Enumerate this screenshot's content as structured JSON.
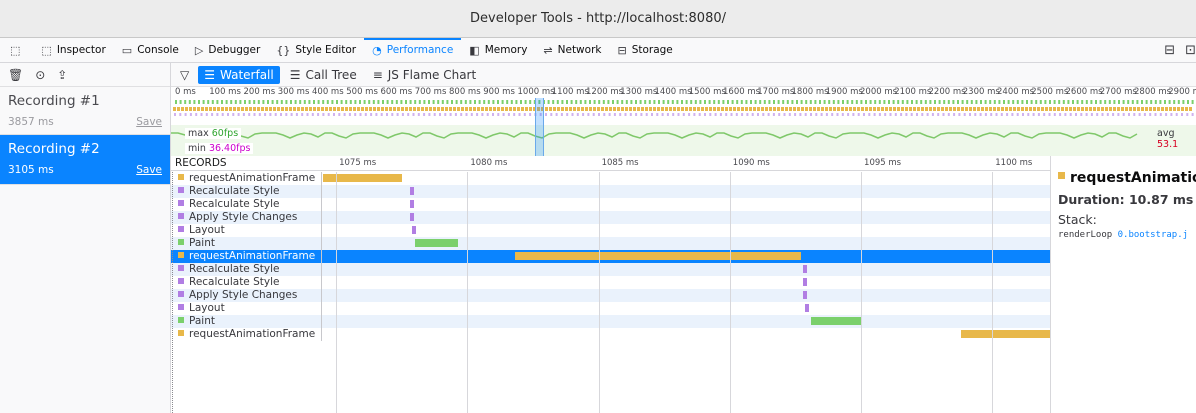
{
  "window": {
    "title": "Developer Tools - http://localhost:8080/"
  },
  "toolbar": {
    "tools": [
      {
        "label": "Inspector",
        "icon": "inspector-icon",
        "glyph": "⬚"
      },
      {
        "label": "Console",
        "icon": "console-icon",
        "glyph": "▭"
      },
      {
        "label": "Debugger",
        "icon": "debugger-icon",
        "glyph": "▷"
      },
      {
        "label": "Style Editor",
        "icon": "style-editor-icon",
        "glyph": "{}"
      },
      {
        "label": "Performance",
        "icon": "performance-icon",
        "glyph": "◔",
        "active": true
      },
      {
        "label": "Memory",
        "icon": "memory-icon",
        "glyph": "◧"
      },
      {
        "label": "Network",
        "icon": "network-icon",
        "glyph": "⇌"
      },
      {
        "label": "Storage",
        "icon": "storage-icon",
        "glyph": "⊟"
      }
    ]
  },
  "sidebar": {
    "recordings": [
      {
        "name": "Recording #1",
        "duration": "3857 ms",
        "save": "Save",
        "selected": false
      },
      {
        "name": "Recording #2",
        "duration": "3105 ms",
        "save": "Save",
        "selected": true
      }
    ]
  },
  "subtabs": [
    {
      "label": "Waterfall",
      "icon": "waterfall-icon",
      "active": true
    },
    {
      "label": "Call Tree",
      "icon": "call-tree-icon",
      "active": false
    },
    {
      "label": "JS Flame Chart",
      "icon": "flame-chart-icon",
      "active": false
    }
  ],
  "overview": {
    "ruler": [
      "0 ms",
      "100 ms",
      "200 ms",
      "300 ms",
      "400 ms",
      "500 ms",
      "600 ms",
      "700 ms",
      "800 ms",
      "900 ms",
      "1000 ms",
      "1100 ms",
      "1200 ms",
      "1300 ms",
      "1400 ms",
      "1500 ms",
      "1600 ms",
      "1700 ms",
      "1800 ms",
      "1900 ms",
      "2000 ms",
      "2100 ms",
      "2200 ms",
      "2300 ms",
      "2400 ms",
      "2500 ms",
      "2600 ms",
      "2700 ms",
      "2800 ms",
      "2900 ms"
    ],
    "fps": {
      "max_label": "max",
      "max_value": "60fps",
      "min_label": "min",
      "min_value": "36.40fps",
      "avg_label": "avg",
      "avg_value": "53.1"
    }
  },
  "waterfall": {
    "records_header": "RECORDS",
    "ticks": [
      "1075 ms",
      "1080 ms",
      "1085 ms",
      "1090 ms",
      "1095 ms",
      "1100 ms"
    ],
    "tick_values": [
      1075,
      1080,
      1085,
      1090,
      1095,
      1100
    ],
    "view_range_ms": [
      1074.5,
      1102.2
    ],
    "markers": [
      {
        "name": "requestAnimationFrame",
        "type": "script",
        "start": 1074.5,
        "end": 1077.5
      },
      {
        "name": "Recalculate Style",
        "type": "style",
        "start": 1077.8,
        "end": 1077.95
      },
      {
        "name": "Recalculate Style",
        "type": "style",
        "start": 1077.8,
        "end": 1077.95
      },
      {
        "name": "Apply Style Changes",
        "type": "style",
        "start": 1077.8,
        "end": 1077.95
      },
      {
        "name": "Layout",
        "type": "style",
        "start": 1077.9,
        "end": 1078.05
      },
      {
        "name": "Paint",
        "type": "paint",
        "start": 1078.0,
        "end": 1079.65
      },
      {
        "name": "requestAnimationFrame",
        "type": "script",
        "start": 1081.8,
        "end": 1092.7,
        "selected": true
      },
      {
        "name": "Recalculate Style",
        "type": "style",
        "start": 1092.8,
        "end": 1092.95
      },
      {
        "name": "Recalculate Style",
        "type": "style",
        "start": 1092.8,
        "end": 1092.95
      },
      {
        "name": "Apply Style Changes",
        "type": "style",
        "start": 1092.8,
        "end": 1092.95
      },
      {
        "name": "Layout",
        "type": "style",
        "start": 1092.85,
        "end": 1093.0
      },
      {
        "name": "Paint",
        "type": "paint",
        "start": 1093.1,
        "end": 1095.0
      },
      {
        "name": "requestAnimationFrame",
        "type": "script",
        "start": 1098.8,
        "end": 1102.2
      }
    ]
  },
  "details": {
    "title": "requestAnimation",
    "duration": "Duration: 10.87 ms",
    "stack_label": "Stack:",
    "stack_fn": "renderLoop",
    "stack_src": "0.bootstrap.j"
  },
  "colors": {
    "accent": "#0a84ff",
    "script": "#e8b84a",
    "style": "#b17ee3",
    "paint": "#7bd06c",
    "fps_line": "#7fc86a"
  }
}
